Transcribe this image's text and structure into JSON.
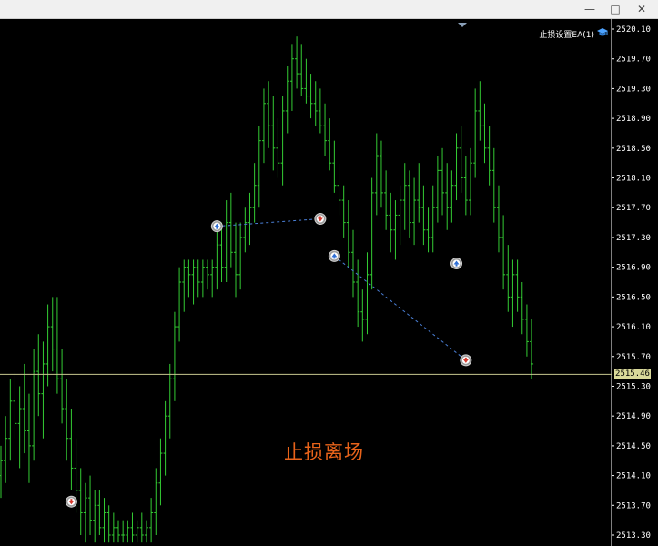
{
  "window": {
    "minimize_icon": "minimize-icon",
    "maximize_icon": "maximize-icon",
    "close_icon": "close-icon"
  },
  "ea_label": {
    "text": "止损设置EA(1)",
    "icon": "graduation-cap-icon"
  },
  "annotation": "止损离场",
  "current_price": "2515.46",
  "colors": {
    "candle": "#33cc33",
    "price_line": "#c8c890",
    "annotation": "#e8631a",
    "trade_line": "#4a7fd6",
    "axis_text": "#ffffff"
  },
  "chart_data": {
    "type": "bar",
    "symbol_timeframe": "",
    "y_ticks": [
      "2520.10",
      "2519.70",
      "2519.30",
      "2518.90",
      "2518.50",
      "2518.10",
      "2517.70",
      "2517.30",
      "2516.90",
      "2516.50",
      "2516.10",
      "2515.70",
      "2515.30",
      "2514.90",
      "2514.50",
      "2514.10",
      "2513.70",
      "2513.30"
    ],
    "ylim": [
      2513.15,
      2520.15
    ],
    "current_price": 2515.46,
    "bars": [
      {
        "o": 2514.1,
        "h": 2514.5,
        "l": 2513.8,
        "c": 2514.3
      },
      {
        "o": 2514.3,
        "h": 2514.9,
        "l": 2514.0,
        "c": 2514.6
      },
      {
        "o": 2514.6,
        "h": 2515.4,
        "l": 2514.3,
        "c": 2515.1
      },
      {
        "o": 2515.1,
        "h": 2515.5,
        "l": 2514.6,
        "c": 2514.8
      },
      {
        "o": 2514.8,
        "h": 2515.3,
        "l": 2514.2,
        "c": 2515.0
      },
      {
        "o": 2515.0,
        "h": 2515.6,
        "l": 2514.4,
        "c": 2514.7
      },
      {
        "o": 2514.7,
        "h": 2515.2,
        "l": 2514.0,
        "c": 2514.5
      },
      {
        "o": 2514.5,
        "h": 2515.8,
        "l": 2514.3,
        "c": 2515.5
      },
      {
        "o": 2515.5,
        "h": 2516.0,
        "l": 2514.9,
        "c": 2515.2
      },
      {
        "o": 2515.2,
        "h": 2515.9,
        "l": 2514.6,
        "c": 2515.6
      },
      {
        "o": 2515.6,
        "h": 2516.4,
        "l": 2515.3,
        "c": 2516.1
      },
      {
        "o": 2516.1,
        "h": 2516.5,
        "l": 2515.5,
        "c": 2515.8
      },
      {
        "o": 2515.8,
        "h": 2516.5,
        "l": 2515.2,
        "c": 2515.4
      },
      {
        "o": 2515.4,
        "h": 2515.8,
        "l": 2514.8,
        "c": 2515.0
      },
      {
        "o": 2515.0,
        "h": 2515.4,
        "l": 2514.3,
        "c": 2514.6
      },
      {
        "o": 2514.6,
        "h": 2515.0,
        "l": 2513.9,
        "c": 2514.2
      },
      {
        "o": 2514.2,
        "h": 2514.6,
        "l": 2513.6,
        "c": 2513.9
      },
      {
        "o": 2513.9,
        "h": 2514.2,
        "l": 2513.3,
        "c": 2513.6
      },
      {
        "o": 2513.6,
        "h": 2514.0,
        "l": 2513.2,
        "c": 2513.8
      },
      {
        "o": 2513.8,
        "h": 2514.1,
        "l": 2513.3,
        "c": 2513.5
      },
      {
        "o": 2513.5,
        "h": 2513.9,
        "l": 2513.2,
        "c": 2513.7
      },
      {
        "o": 2513.7,
        "h": 2513.9,
        "l": 2513.3,
        "c": 2513.4
      },
      {
        "o": 2513.4,
        "h": 2513.8,
        "l": 2513.2,
        "c": 2513.6
      },
      {
        "o": 2513.6,
        "h": 2513.7,
        "l": 2513.2,
        "c": 2513.3
      },
      {
        "o": 2513.3,
        "h": 2513.6,
        "l": 2513.2,
        "c": 2513.4
      },
      {
        "o": 2513.4,
        "h": 2513.5,
        "l": 2513.2,
        "c": 2513.3
      },
      {
        "o": 2513.3,
        "h": 2513.5,
        "l": 2513.2,
        "c": 2513.3
      },
      {
        "o": 2513.3,
        "h": 2513.5,
        "l": 2513.2,
        "c": 2513.4
      },
      {
        "o": 2513.4,
        "h": 2513.6,
        "l": 2513.2,
        "c": 2513.3
      },
      {
        "o": 2513.3,
        "h": 2513.5,
        "l": 2513.2,
        "c": 2513.4
      },
      {
        "o": 2513.4,
        "h": 2513.6,
        "l": 2513.2,
        "c": 2513.3
      },
      {
        "o": 2513.3,
        "h": 2513.5,
        "l": 2513.2,
        "c": 2513.4
      },
      {
        "o": 2513.4,
        "h": 2513.8,
        "l": 2513.2,
        "c": 2513.6
      },
      {
        "o": 2513.6,
        "h": 2514.2,
        "l": 2513.3,
        "c": 2514.0
      },
      {
        "o": 2514.0,
        "h": 2514.6,
        "l": 2513.7,
        "c": 2514.4
      },
      {
        "o": 2514.4,
        "h": 2515.1,
        "l": 2514.1,
        "c": 2514.9
      },
      {
        "o": 2514.9,
        "h": 2515.6,
        "l": 2514.6,
        "c": 2515.4
      },
      {
        "o": 2515.4,
        "h": 2516.3,
        "l": 2515.1,
        "c": 2516.1
      },
      {
        "o": 2516.1,
        "h": 2516.9,
        "l": 2515.9,
        "c": 2516.7
      },
      {
        "o": 2516.7,
        "h": 2517.0,
        "l": 2516.3,
        "c": 2516.9
      },
      {
        "o": 2516.9,
        "h": 2517.0,
        "l": 2516.5,
        "c": 2516.8
      },
      {
        "o": 2516.8,
        "h": 2517.0,
        "l": 2516.4,
        "c": 2516.9
      },
      {
        "o": 2516.9,
        "h": 2517.0,
        "l": 2516.5,
        "c": 2516.7
      },
      {
        "o": 2516.7,
        "h": 2517.0,
        "l": 2516.5,
        "c": 2516.9
      },
      {
        "o": 2516.9,
        "h": 2517.0,
        "l": 2516.6,
        "c": 2516.8
      },
      {
        "o": 2516.8,
        "h": 2517.0,
        "l": 2516.5,
        "c": 2516.9
      },
      {
        "o": 2516.9,
        "h": 2517.4,
        "l": 2516.6,
        "c": 2517.2
      },
      {
        "o": 2517.2,
        "h": 2517.5,
        "l": 2516.7,
        "c": 2516.9
      },
      {
        "o": 2516.9,
        "h": 2517.8,
        "l": 2516.7,
        "c": 2517.5
      },
      {
        "o": 2517.5,
        "h": 2517.9,
        "l": 2516.9,
        "c": 2517.1
      },
      {
        "o": 2517.1,
        "h": 2517.5,
        "l": 2516.5,
        "c": 2516.8
      },
      {
        "o": 2516.8,
        "h": 2517.5,
        "l": 2516.6,
        "c": 2517.3
      },
      {
        "o": 2517.3,
        "h": 2517.7,
        "l": 2517.1,
        "c": 2517.5
      },
      {
        "o": 2517.5,
        "h": 2517.9,
        "l": 2517.2,
        "c": 2517.7
      },
      {
        "o": 2517.7,
        "h": 2518.3,
        "l": 2517.5,
        "c": 2518.0
      },
      {
        "o": 2518.0,
        "h": 2518.8,
        "l": 2517.7,
        "c": 2518.6
      },
      {
        "o": 2518.6,
        "h": 2519.3,
        "l": 2518.3,
        "c": 2519.1
      },
      {
        "o": 2519.1,
        "h": 2519.4,
        "l": 2518.5,
        "c": 2518.8
      },
      {
        "o": 2518.8,
        "h": 2519.2,
        "l": 2518.2,
        "c": 2518.5
      },
      {
        "o": 2518.5,
        "h": 2518.9,
        "l": 2518.1,
        "c": 2518.3
      },
      {
        "o": 2518.3,
        "h": 2519.2,
        "l": 2518.0,
        "c": 2519.0
      },
      {
        "o": 2519.0,
        "h": 2519.6,
        "l": 2518.7,
        "c": 2519.4
      },
      {
        "o": 2519.4,
        "h": 2519.9,
        "l": 2519.0,
        "c": 2519.7
      },
      {
        "o": 2519.7,
        "h": 2520.0,
        "l": 2519.3,
        "c": 2519.5
      },
      {
        "o": 2519.5,
        "h": 2519.9,
        "l": 2519.2,
        "c": 2519.3
      },
      {
        "o": 2519.3,
        "h": 2519.7,
        "l": 2519.1,
        "c": 2519.2
      },
      {
        "o": 2519.2,
        "h": 2519.5,
        "l": 2518.9,
        "c": 2519.1
      },
      {
        "o": 2519.1,
        "h": 2519.4,
        "l": 2518.8,
        "c": 2519.0
      },
      {
        "o": 2519.0,
        "h": 2519.3,
        "l": 2518.7,
        "c": 2518.8
      },
      {
        "o": 2518.8,
        "h": 2519.1,
        "l": 2518.4,
        "c": 2518.6
      },
      {
        "o": 2518.6,
        "h": 2518.9,
        "l": 2518.2,
        "c": 2518.3
      },
      {
        "o": 2518.3,
        "h": 2518.6,
        "l": 2517.9,
        "c": 2518.0
      },
      {
        "o": 2518.0,
        "h": 2518.3,
        "l": 2517.6,
        "c": 2517.8
      },
      {
        "o": 2517.8,
        "h": 2518.0,
        "l": 2517.3,
        "c": 2517.5
      },
      {
        "o": 2517.5,
        "h": 2517.8,
        "l": 2516.9,
        "c": 2517.1
      },
      {
        "o": 2517.1,
        "h": 2517.4,
        "l": 2516.5,
        "c": 2516.7
      },
      {
        "o": 2516.7,
        "h": 2517.0,
        "l": 2516.1,
        "c": 2516.3
      },
      {
        "o": 2516.3,
        "h": 2516.6,
        "l": 2515.9,
        "c": 2516.2
      },
      {
        "o": 2516.2,
        "h": 2517.1,
        "l": 2516.0,
        "c": 2516.8
      },
      {
        "o": 2516.8,
        "h": 2518.1,
        "l": 2516.6,
        "c": 2517.9
      },
      {
        "o": 2517.9,
        "h": 2518.7,
        "l": 2517.6,
        "c": 2518.4
      },
      {
        "o": 2518.4,
        "h": 2518.6,
        "l": 2517.7,
        "c": 2517.9
      },
      {
        "o": 2517.9,
        "h": 2518.2,
        "l": 2517.4,
        "c": 2517.6
      },
      {
        "o": 2517.6,
        "h": 2517.9,
        "l": 2517.1,
        "c": 2517.4
      },
      {
        "o": 2517.4,
        "h": 2517.8,
        "l": 2517.0,
        "c": 2517.6
      },
      {
        "o": 2517.6,
        "h": 2518.0,
        "l": 2517.2,
        "c": 2517.8
      },
      {
        "o": 2517.8,
        "h": 2518.3,
        "l": 2517.4,
        "c": 2518.0
      },
      {
        "o": 2518.0,
        "h": 2518.2,
        "l": 2517.3,
        "c": 2517.5
      },
      {
        "o": 2517.5,
        "h": 2518.1,
        "l": 2517.2,
        "c": 2517.8
      },
      {
        "o": 2517.8,
        "h": 2518.3,
        "l": 2517.5,
        "c": 2517.7
      },
      {
        "o": 2517.7,
        "h": 2518.0,
        "l": 2517.2,
        "c": 2517.4
      },
      {
        "o": 2517.4,
        "h": 2517.7,
        "l": 2517.1,
        "c": 2517.3
      },
      {
        "o": 2517.3,
        "h": 2518.0,
        "l": 2517.1,
        "c": 2517.7
      },
      {
        "o": 2517.7,
        "h": 2518.4,
        "l": 2517.5,
        "c": 2518.2
      },
      {
        "o": 2518.2,
        "h": 2518.5,
        "l": 2517.6,
        "c": 2517.9
      },
      {
        "o": 2517.9,
        "h": 2518.3,
        "l": 2517.4,
        "c": 2517.7
      },
      {
        "o": 2517.7,
        "h": 2518.2,
        "l": 2517.5,
        "c": 2518.0
      },
      {
        "o": 2518.0,
        "h": 2518.7,
        "l": 2517.8,
        "c": 2518.5
      },
      {
        "o": 2518.5,
        "h": 2518.8,
        "l": 2517.9,
        "c": 2518.1
      },
      {
        "o": 2518.1,
        "h": 2518.4,
        "l": 2517.6,
        "c": 2517.8
      },
      {
        "o": 2517.8,
        "h": 2518.5,
        "l": 2517.6,
        "c": 2518.3
      },
      {
        "o": 2518.3,
        "h": 2519.3,
        "l": 2518.1,
        "c": 2519.0
      },
      {
        "o": 2519.0,
        "h": 2519.4,
        "l": 2518.6,
        "c": 2518.8
      },
      {
        "o": 2518.8,
        "h": 2519.1,
        "l": 2518.3,
        "c": 2518.5
      },
      {
        "o": 2518.5,
        "h": 2518.8,
        "l": 2518.0,
        "c": 2518.2
      },
      {
        "o": 2518.2,
        "h": 2518.5,
        "l": 2517.5,
        "c": 2517.7
      },
      {
        "o": 2517.7,
        "h": 2518.0,
        "l": 2517.1,
        "c": 2517.3
      },
      {
        "o": 2517.3,
        "h": 2517.6,
        "l": 2516.6,
        "c": 2516.8
      },
      {
        "o": 2516.8,
        "h": 2517.2,
        "l": 2516.3,
        "c": 2516.5
      },
      {
        "o": 2516.5,
        "h": 2517.0,
        "l": 2516.1,
        "c": 2516.8
      },
      {
        "o": 2516.8,
        "h": 2517.0,
        "l": 2516.3,
        "c": 2516.5
      },
      {
        "o": 2516.5,
        "h": 2516.7,
        "l": 2516.0,
        "c": 2516.2
      },
      {
        "o": 2516.2,
        "h": 2516.4,
        "l": 2515.7,
        "c": 2515.9
      },
      {
        "o": 2515.9,
        "h": 2516.2,
        "l": 2515.4,
        "c": 2515.6
      }
    ],
    "trades": [
      {
        "from_bar": 46,
        "to_bar": 68,
        "entry": 2517.45,
        "exit": 2517.55,
        "entry_marker": "buy-entry-icon",
        "exit_marker": "sell-exit-icon"
      },
      {
        "from_bar": 71,
        "to_bar": 99,
        "entry": 2517.05,
        "exit": 2515.65,
        "entry_marker": "buy-entry-icon",
        "exit_marker": "sell-exit-icon"
      },
      {
        "from_bar": 97,
        "to_bar": 97,
        "entry": 2516.95,
        "exit": 2516.95,
        "entry_marker": "buy-entry-icon",
        "exit_marker": ""
      },
      {
        "from_bar": 15,
        "to_bar": 15,
        "entry": 2513.75,
        "exit": 2513.75,
        "entry_marker": "sell-exit-icon",
        "exit_marker": ""
      }
    ]
  }
}
